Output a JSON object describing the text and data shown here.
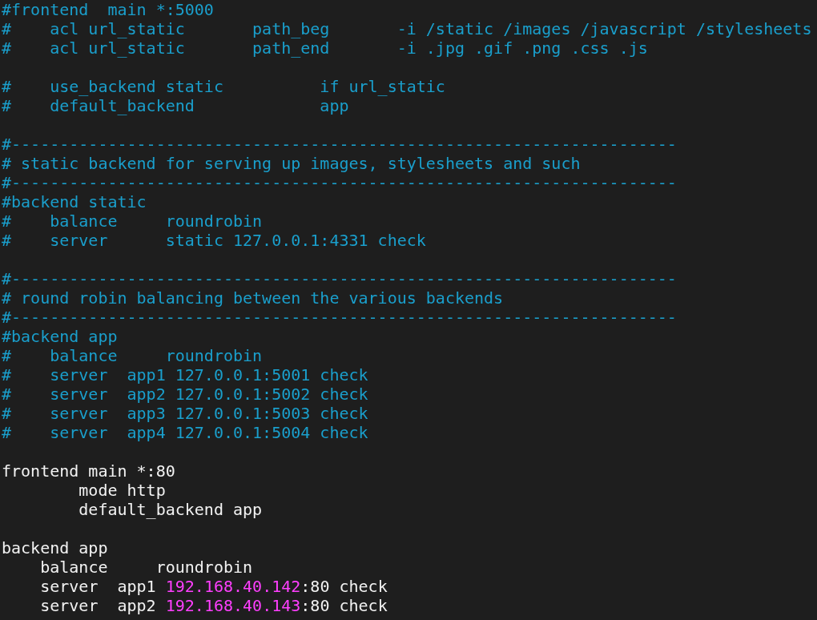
{
  "editor": {
    "blocks": [
      {
        "lines": [
          {
            "kind": "comment",
            "text": "#frontend  main *:5000"
          },
          {
            "kind": "comment",
            "text": "#    acl url_static       path_beg       -i /static /images /javascript /stylesheets"
          },
          {
            "kind": "comment",
            "text": "#    acl url_static       path_end       -i .jpg .gif .png .css .js"
          }
        ]
      },
      {
        "lines": [
          {
            "kind": "comment",
            "text": "#    use_backend static          if url_static"
          },
          {
            "kind": "comment",
            "text": "#    default_backend             app"
          }
        ]
      },
      {
        "lines": [
          {
            "kind": "comment",
            "text": "#---------------------------------------------------------------------"
          },
          {
            "kind": "comment",
            "text": "# static backend for serving up images, stylesheets and such"
          },
          {
            "kind": "comment",
            "text": "#---------------------------------------------------------------------"
          },
          {
            "kind": "comment",
            "text": "#backend static"
          },
          {
            "kind": "comment",
            "text": "#    balance     roundrobin"
          },
          {
            "kind": "comment",
            "text": "#    server      static 127.0.0.1:4331 check"
          }
        ]
      },
      {
        "lines": [
          {
            "kind": "comment",
            "text": "#---------------------------------------------------------------------"
          },
          {
            "kind": "comment",
            "text": "# round robin balancing between the various backends"
          },
          {
            "kind": "comment",
            "text": "#---------------------------------------------------------------------"
          },
          {
            "kind": "comment",
            "text": "#backend app"
          },
          {
            "kind": "comment",
            "text": "#    balance     roundrobin"
          },
          {
            "kind": "comment",
            "text": "#    server  app1 127.0.0.1:5001 check"
          },
          {
            "kind": "comment",
            "text": "#    server  app2 127.0.0.1:5002 check"
          },
          {
            "kind": "comment",
            "text": "#    server  app3 127.0.0.1:5003 check"
          },
          {
            "kind": "comment",
            "text": "#    server  app4 127.0.0.1:5004 check"
          }
        ]
      },
      {
        "lines": [
          {
            "kind": "code",
            "text": "frontend main *:80"
          },
          {
            "kind": "code",
            "text": "        mode http"
          },
          {
            "kind": "code",
            "text": "        default_backend app"
          }
        ]
      },
      {
        "lines": [
          {
            "kind": "code",
            "text": "backend app"
          },
          {
            "kind": "code",
            "text": "    balance     roundrobin"
          },
          {
            "kind": "mixed",
            "segments": [
              {
                "kind": "plain",
                "text": "    server  app1 "
              },
              {
                "kind": "address",
                "text": "192.168.40.142"
              },
              {
                "kind": "plain",
                "text": ":80 check"
              }
            ]
          },
          {
            "kind": "mixed",
            "segments": [
              {
                "kind": "plain",
                "text": "    server  app2 "
              },
              {
                "kind": "address",
                "text": "192.168.40.143"
              },
              {
                "kind": "plain",
                "text": ":80 check"
              }
            ]
          }
        ]
      }
    ]
  }
}
